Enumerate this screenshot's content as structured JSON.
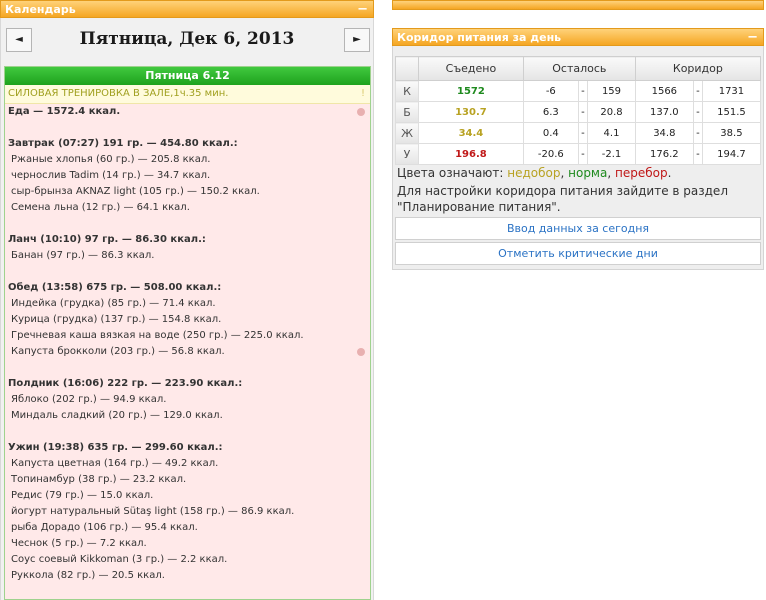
{
  "calendar": {
    "header_title": "Календарь",
    "collapse_glyph": "−",
    "prev_glyph": "◄",
    "next_glyph": "►",
    "date_title": "Пятница, Дек 6, 2013",
    "day_bar": "Пятница 6.12",
    "training": "СИЛОВАЯ ТРЕНИРОВКА В ЗАЛЕ,1ч.35 мин.",
    "training_flag": "!",
    "food_lines": [
      {
        "t": "bold",
        "text": "Еда — 1572.4 ккал."
      },
      {
        "t": "gap",
        "text": ""
      },
      {
        "t": "bold",
        "text": "Завтрак (07:27) 191 гр. — 454.80 ккал.:"
      },
      {
        "t": "item",
        "text": "Ржаные хлопья (60 гр.) — 205.8 ккал."
      },
      {
        "t": "item",
        "text": "чернослив Tadim (14 гр.) — 34.7 ккал."
      },
      {
        "t": "item",
        "text": "сыр-брынза AKNAZ light (105 гр.) — 150.2 ккал."
      },
      {
        "t": "item",
        "text": "Семена льна (12 гр.) — 64.1 ккал."
      },
      {
        "t": "gap",
        "text": ""
      },
      {
        "t": "bold",
        "text": "Ланч (10:10) 97 гр. — 86.30 ккал.:"
      },
      {
        "t": "item",
        "text": "Банан (97 гр.) — 86.3 ккал."
      },
      {
        "t": "gap",
        "text": ""
      },
      {
        "t": "bold",
        "text": "Обед (13:58) 675 гр. — 508.00 ккал.:"
      },
      {
        "t": "item",
        "text": "Индейка (грудка) (85 гр.) — 71.4 ккал."
      },
      {
        "t": "item",
        "text": "Курица (грудка) (137 гр.) — 154.8 ккал."
      },
      {
        "t": "item",
        "text": "Гречневая каша вязкая на воде (250 гр.) — 225.0 ккал."
      },
      {
        "t": "item",
        "text": "Капуста брокколи (203 гр.) — 56.8 ккал."
      },
      {
        "t": "gap",
        "text": ""
      },
      {
        "t": "bold",
        "text": "Полдник (16:06) 222 гр. — 223.90 ккал.:"
      },
      {
        "t": "item",
        "text": "Яблоко (202 гр.) — 94.9 ккал."
      },
      {
        "t": "item",
        "text": "Миндаль сладкий (20 гр.) — 129.0 ккал."
      },
      {
        "t": "gap",
        "text": ""
      },
      {
        "t": "bold",
        "text": "Ужин (19:38) 635 гр. — 299.60 ккал.:"
      },
      {
        "t": "item",
        "text": "Капуста цветная (164 гр.) — 49.2 ккал."
      },
      {
        "t": "item",
        "text": "Топинамбур (38 гр.) — 23.2 ккал."
      },
      {
        "t": "item",
        "text": "Редис (79 гр.) — 15.0 ккал."
      },
      {
        "t": "item",
        "text": "йогурт натуральный Sütaş light (158 гр.) — 86.9 ккал."
      },
      {
        "t": "item",
        "text": "рыба Дорадо (106 гр.) — 95.4 ккал."
      },
      {
        "t": "item",
        "text": "Чеснок (5 гр.) — 7.2 ккал."
      },
      {
        "t": "item",
        "text": "Соус соевый Kikkoman (3 гр.) — 2.2 ккал."
      },
      {
        "t": "item",
        "text": "Руккола (82 гр.) — 20.5 ккал."
      }
    ]
  },
  "corridor": {
    "header_title": "Коридор питания за день",
    "collapse_glyph": "−",
    "columns": [
      "Съедено",
      "Осталось",
      "Коридор"
    ],
    "dash": "-",
    "colors": {
      "under": "#b8a222",
      "norm": "#1e8a1e",
      "over": "#c01818"
    },
    "rows": [
      {
        "label": "К",
        "eaten": "1572",
        "status": "norm",
        "rem_min": "-6",
        "rem_max": "159",
        "cor_min": "1566",
        "cor_max": "1731"
      },
      {
        "label": "Б",
        "eaten": "130.7",
        "status": "under",
        "rem_min": "6.3",
        "rem_max": "20.8",
        "cor_min": "137.0",
        "cor_max": "151.5"
      },
      {
        "label": "Ж",
        "eaten": "34.4",
        "status": "under",
        "rem_min": "0.4",
        "rem_max": "4.1",
        "cor_min": "34.8",
        "cor_max": "38.5"
      },
      {
        "label": "У",
        "eaten": "196.8",
        "status": "over",
        "rem_min": "-20.6",
        "rem_max": "-2.1",
        "cor_min": "176.2",
        "cor_max": "194.7"
      }
    ],
    "legend_prefix": "Цвета означают: ",
    "legend_under": "недобор",
    "legend_sep1": ", ",
    "legend_norm": "норма",
    "legend_sep2": ", ",
    "legend_over": "перебор",
    "legend_end": ".",
    "hint": "Для настройки коридора питания зайдите в раздел \"Планирование питания\".",
    "btn_enter": "Ввод данных за сегодня",
    "btn_critical": "Отметить критические дни"
  }
}
